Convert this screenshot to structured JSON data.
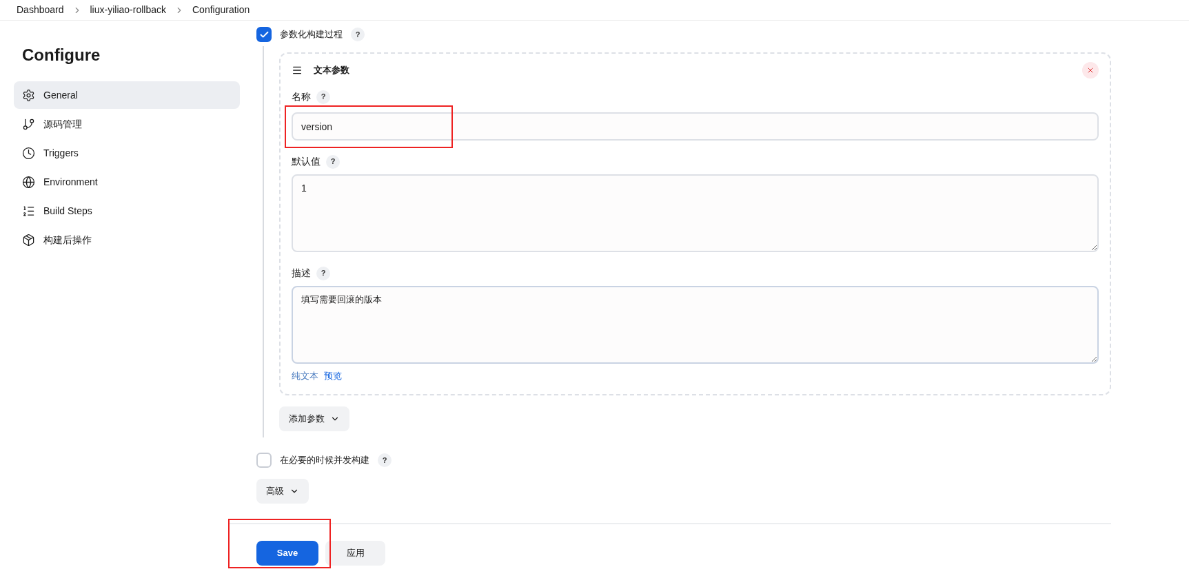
{
  "breadcrumbs": [
    "Dashboard",
    "liux-yiliao-rollback",
    "Configuration"
  ],
  "sidebar": {
    "title": "Configure",
    "items": [
      {
        "label": "General",
        "kind": "gear",
        "selected": true
      },
      {
        "label": "源码管理",
        "kind": "branch",
        "selected": false
      },
      {
        "label": "Triggers",
        "kind": "clock",
        "selected": false
      },
      {
        "label": "Environment",
        "kind": "globe",
        "selected": false
      },
      {
        "label": "Build Steps",
        "kind": "list",
        "selected": false
      },
      {
        "label": "构建后操作",
        "kind": "box",
        "selected": false
      }
    ]
  },
  "parameterized": {
    "label": "参数化构建过程",
    "checked": true,
    "help": "?"
  },
  "parameter": {
    "title": "文本参数",
    "name_label": "名称",
    "name_help": "?",
    "name_value": "version",
    "name_highlighted": true,
    "default_label": "默认值",
    "default_help": "?",
    "default_value": "1",
    "desc_label": "描述",
    "desc_help": "?",
    "desc_value": "填写需要回滚的版本",
    "links": [
      "纯文本",
      "预览"
    ]
  },
  "add_parameter": "添加参数",
  "concurrent": {
    "label": "在必要的时候并发构建",
    "checked": false,
    "help": "?"
  },
  "advanced": "高级",
  "save": {
    "label": "Save",
    "highlighted": true
  },
  "apply": "应用"
}
